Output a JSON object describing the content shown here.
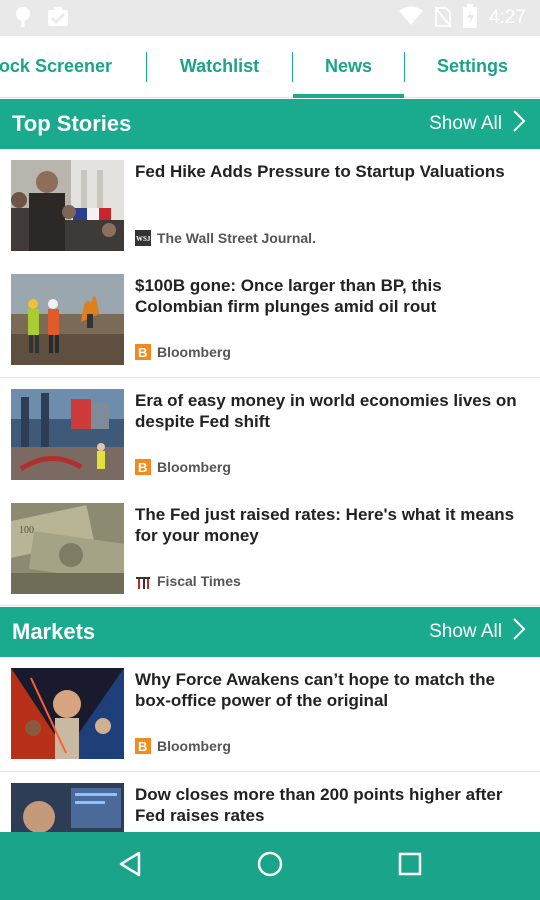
{
  "status_bar": {
    "time": "4:27"
  },
  "tabs": [
    {
      "label": "Stock Screener"
    },
    {
      "label": "Watchlist"
    },
    {
      "label": "News"
    },
    {
      "label": "Settings"
    }
  ],
  "active_tab": "News",
  "sections": [
    {
      "title": "Top Stories",
      "show_all": "Show All",
      "articles": [
        {
          "headline": "Fed Hike Adds Pressure to Startup Valuations",
          "source": "The Wall Street Journal.",
          "source_icon": "wsj-logo",
          "thumb": "protest-photo"
        },
        {
          "headline": "$100B gone: Once larger than BP, this Colombian firm plunges amid oil rout",
          "source": "Bloomberg",
          "source_icon": "bloomberg-logo",
          "thumb": "oil-field-photo"
        },
        {
          "headline": "Era of easy money in world economies lives on despite Fed shift",
          "source": "Bloomberg",
          "source_icon": "bloomberg-logo",
          "thumb": "shipping-port-photo"
        },
        {
          "headline": "The Fed just raised rates: Here's what it means for your money",
          "source": "Fiscal Times",
          "source_icon": "fiscal-times-logo",
          "thumb": "dollar-bills-photo"
        }
      ]
    },
    {
      "title": "Markets",
      "show_all": "Show All",
      "articles": [
        {
          "headline": "Why Force Awakens can’t hope to match the box-office power of the original",
          "source": "Bloomberg",
          "source_icon": "bloomberg-logo",
          "thumb": "movie-poster-photo"
        },
        {
          "headline": "Dow closes more than 200 points higher after Fed raises rates",
          "source": "",
          "source_icon": "",
          "thumb": "trader-screens-photo"
        }
      ]
    }
  ],
  "colors": {
    "accent": "#1aaa8d",
    "nav": "#1aa48a",
    "tab_text": "#1aa589",
    "headline": "#222222",
    "source": "#555555"
  }
}
